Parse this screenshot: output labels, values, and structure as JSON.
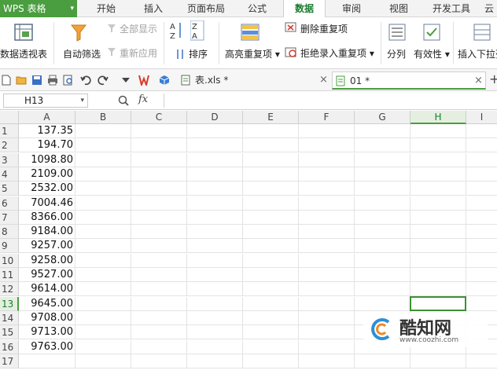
{
  "menubar": {
    "app_label": "WPS 表格",
    "app_caret": "▾",
    "items": [
      "开始",
      "插入",
      "页面布局",
      "公式",
      "数据",
      "审阅",
      "视图",
      "开发工具",
      "云"
    ],
    "active": "数据"
  },
  "ribbon": {
    "pivot_table": "数据透视表",
    "auto_filter": "自动筛选",
    "show_all": "全部显示",
    "reapply": "重新应用",
    "sort": "排序",
    "highlight_duplicates": "高亮重复项",
    "remove_duplicates": "删除重复项",
    "reject_duplicates": "拒绝录入重复项",
    "split_column": "分列",
    "validity": "有效性",
    "insert_dropdown": "插入下拉列"
  },
  "doc_tabs": [
    {
      "label": "表.xls *",
      "close": "×"
    },
    {
      "label": "01 *",
      "close": "×"
    }
  ],
  "new_tab": "+",
  "formula_bar": {
    "name_box": "H13",
    "fx": "fx",
    "content": ""
  },
  "grid": {
    "columns": [
      "A",
      "B",
      "C",
      "D",
      "E",
      "F",
      "G",
      "H",
      "I"
    ],
    "selected_column": "H",
    "rows": [
      "1",
      "2",
      "3",
      "4",
      "5",
      "6",
      "7",
      "8",
      "9",
      "10",
      "11",
      "12",
      "13",
      "14",
      "15",
      "16",
      "17"
    ],
    "selected_row": "13",
    "column_a_values": [
      "137.35",
      "194.70",
      "1098.80",
      "2109.00",
      "2532.00",
      "7004.46",
      "8366.00",
      "9184.00",
      "9257.00",
      "9258.00",
      "9527.00",
      "9614.00",
      "9645.00",
      "9708.00",
      "9713.00",
      "9763.00",
      ""
    ]
  },
  "watermark": {
    "title": "酷知网",
    "url": "www.coozhi.com"
  },
  "colors": {
    "accent": "#4a9e3f",
    "active_text": "#1a7b30"
  }
}
